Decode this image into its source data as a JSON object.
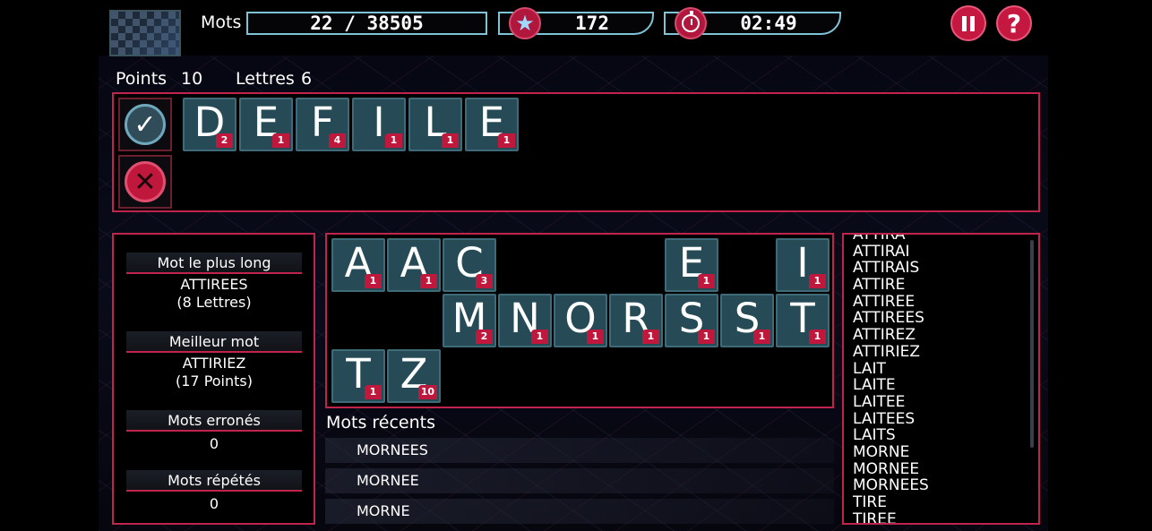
{
  "header": {
    "mots_label": "Mots",
    "words_found": "22 / 38505",
    "score": "172",
    "timer": "02:49",
    "pause_icon": "pause-icon",
    "help_label": "?"
  },
  "stats": {
    "points_label": "Points",
    "points_value": "10",
    "lettres_label": "Lettres",
    "lettres_value": "6"
  },
  "current_word": [
    {
      "letter": "D",
      "points": "2"
    },
    {
      "letter": "E",
      "points": "1"
    },
    {
      "letter": "F",
      "points": "4"
    },
    {
      "letter": "I",
      "points": "1"
    },
    {
      "letter": "L",
      "points": "1"
    },
    {
      "letter": "E",
      "points": "1"
    }
  ],
  "left_panel": {
    "longest_title": "Mot le plus long",
    "longest_word": "ATTIREES",
    "longest_detail": "(8 Lettres)",
    "best_title": "Meilleur mot",
    "best_word": "ATTIRIEZ",
    "best_detail": "(17 Points)",
    "wrong_title": "Mots erronés",
    "wrong_value": "0",
    "repeated_title": "Mots répétés",
    "repeated_value": "0"
  },
  "letters": [
    {
      "letter": "A",
      "points": "1",
      "row": 0,
      "col": 0
    },
    {
      "letter": "A",
      "points": "1",
      "row": 0,
      "col": 1
    },
    {
      "letter": "C",
      "points": "3",
      "row": 0,
      "col": 2
    },
    {
      "letter": "E",
      "points": "1",
      "row": 0,
      "col": 6
    },
    {
      "letter": "I",
      "points": "1",
      "row": 0,
      "col": 8
    },
    {
      "letter": "M",
      "points": "2",
      "row": 1,
      "col": 2
    },
    {
      "letter": "N",
      "points": "1",
      "row": 1,
      "col": 3
    },
    {
      "letter": "O",
      "points": "1",
      "row": 1,
      "col": 4
    },
    {
      "letter": "R",
      "points": "1",
      "row": 1,
      "col": 5
    },
    {
      "letter": "S",
      "points": "1",
      "row": 1,
      "col": 6
    },
    {
      "letter": "S",
      "points": "1",
      "row": 1,
      "col": 7
    },
    {
      "letter": "T",
      "points": "1",
      "row": 1,
      "col": 8
    },
    {
      "letter": "T",
      "points": "1",
      "row": 2,
      "col": 0
    },
    {
      "letter": "Z",
      "points": "10",
      "row": 2,
      "col": 1
    }
  ],
  "recent": {
    "title": "Mots récents",
    "words": [
      "MORNEES",
      "MORNEE",
      "MORNE"
    ]
  },
  "word_list": [
    "ATTIRA",
    "ATTIRAI",
    "ATTIRAIS",
    "ATTIRE",
    "ATTIREE",
    "ATTIREES",
    "ATTIREZ",
    "ATTIRIEZ",
    "LAIT",
    "LAITE",
    "LAITEE",
    "LAITEES",
    "LAITS",
    "MORNE",
    "MORNEE",
    "MORNEES",
    "TIRE",
    "TIREE"
  ],
  "colors": {
    "accent": "#c0234b",
    "tile": "#264b57",
    "hud_border": "#7ec4d6"
  }
}
